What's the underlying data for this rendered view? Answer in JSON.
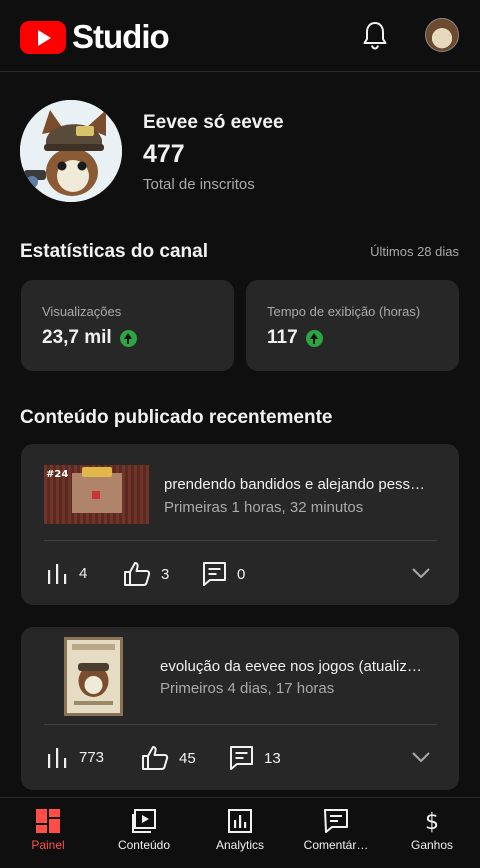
{
  "header": {
    "brand": "Studio",
    "icons": {
      "logo": "youtube-logo-icon",
      "notifications": "bell-icon",
      "account": "avatar"
    }
  },
  "channel": {
    "name": "Eevee só eevee",
    "subscribers": "477",
    "subscribers_label": "Total de inscritos"
  },
  "stats": {
    "title": "Estatísticas do canal",
    "period": "Últimos 28 dias",
    "cards": [
      {
        "label": "Visualizações",
        "value": "23,7 mil",
        "trend": "up"
      },
      {
        "label": "Tempo de exibição (horas)",
        "value": "117",
        "trend": "up"
      }
    ]
  },
  "recent": {
    "title": "Conteúdo publicado recentemente",
    "videos": [
      {
        "badge": "#24",
        "title": "prendendo bandidos e alejando pess…",
        "subtitle": "Primeiras 1 horas, 32 minutos",
        "views": "4",
        "likes": "3",
        "comments": "0"
      },
      {
        "title": "evolução da eevee nos jogos (atualiz…",
        "subtitle": "Primeiros 4 dias, 17 horas",
        "views": "773",
        "likes": "45",
        "comments": "13"
      }
    ]
  },
  "nav": {
    "items": [
      {
        "label": "Painel",
        "icon": "dashboard-icon",
        "active": true
      },
      {
        "label": "Conteúdo",
        "icon": "content-icon"
      },
      {
        "label": "Analytics",
        "icon": "analytics-icon"
      },
      {
        "label": "Comentár…",
        "icon": "comments-icon"
      },
      {
        "label": "Ganhos",
        "icon": "earnings-icon"
      }
    ]
  },
  "colors": {
    "background": "#0f0f0f",
    "card": "#272727",
    "accent": "#ff0000",
    "active_nav": "#ff4e45",
    "trend_up": "#2ba640"
  }
}
